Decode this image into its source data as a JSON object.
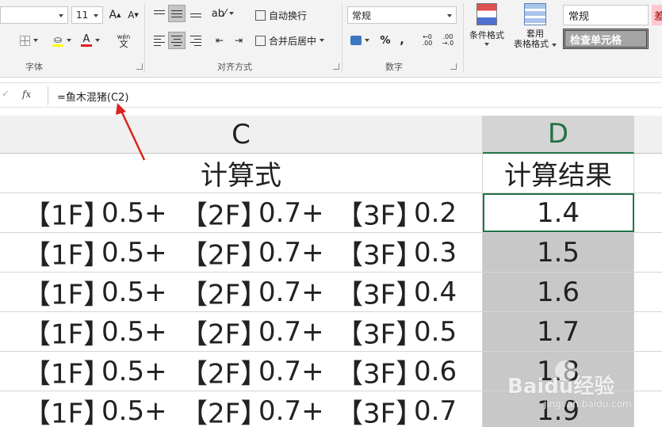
{
  "ribbon": {
    "font": {
      "size": "11",
      "grow_label": "A",
      "shrink_label": "A",
      "font_color_label": "A",
      "phonetic_label": "wén",
      "group_label": "字体"
    },
    "alignment": {
      "wrap_text_label": "自动换行",
      "merge_center_label": "合并后居中",
      "group_label": "对齐方式"
    },
    "number": {
      "format_value": "常规",
      "percent_label": "%",
      "comma_label": ",",
      "inc_decimal_label": ".00",
      "dec_decimal_label": ".00",
      "group_label": "数字"
    },
    "styles": {
      "conditional_formatting_label": "条件格式",
      "table_format_label_line1": "套用",
      "table_format_label_line2": "表格格式",
      "style_normal_label": "常规",
      "style_check_cell_label": "检查单元格",
      "style_bad_label": "差"
    }
  },
  "formula_bar": {
    "fx_label": "fx",
    "formula": "=鱼木混猪(C2)"
  },
  "sheet": {
    "col_c_header": "C",
    "col_d_header": "D",
    "header_row": {
      "c": "计算式",
      "d": "计算结果"
    },
    "rows": [
      {
        "c": [
          "【1F】",
          "0.5+",
          "【2F】",
          "0.7+",
          "【3F】",
          "0.2"
        ],
        "d": "1.4"
      },
      {
        "c": [
          "【1F】",
          "0.5+",
          "【2F】",
          "0.7+",
          "【3F】",
          "0.3"
        ],
        "d": "1.5"
      },
      {
        "c": [
          "【1F】",
          "0.5+",
          "【2F】",
          "0.7+",
          "【3F】",
          "0.4"
        ],
        "d": "1.6"
      },
      {
        "c": [
          "【1F】",
          "0.5+",
          "【2F】",
          "0.7+",
          "【3F】",
          "0.5"
        ],
        "d": "1.7"
      },
      {
        "c": [
          "【1F】",
          "0.5+",
          "【2F】",
          "0.7+",
          "【3F】",
          "0.6"
        ],
        "d": "1.8"
      },
      {
        "c": [
          "【1F】",
          "0.5+",
          "【2F】",
          "0.7+",
          "【3F】",
          "0.7"
        ],
        "d": "1.9"
      }
    ]
  },
  "watermark": {
    "brand": "Baidu经验",
    "url": "jingyan.baidu.com"
  },
  "colors": {
    "accent": "#217346",
    "arrow": "#d9251d",
    "selection_fill": "#c8c8c8"
  }
}
